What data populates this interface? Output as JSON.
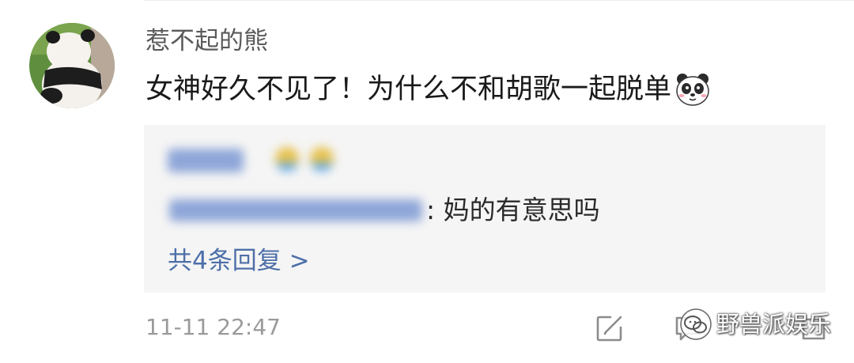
{
  "comment": {
    "username": "惹不起的熊",
    "text": "女神好久不见了！为什么不和胡歌一起脱单",
    "text_emoji": "panda-icon",
    "timestamp": "11-11 22:47"
  },
  "reply_preview": {
    "reply_text": ": 妈的有意思吗",
    "replies_link": "共4条回复 >"
  },
  "actions": {
    "edit_icon": "edit-icon",
    "comment_icon": "comment-icon",
    "share_icon": "share-icon"
  },
  "watermark": {
    "text": "野兽派娱乐"
  },
  "colors": {
    "reply_box_bg": "#f5f5f5",
    "link": "#4e6fa8",
    "username": "#5a5a5a",
    "timestamp": "#9a9a9a"
  }
}
